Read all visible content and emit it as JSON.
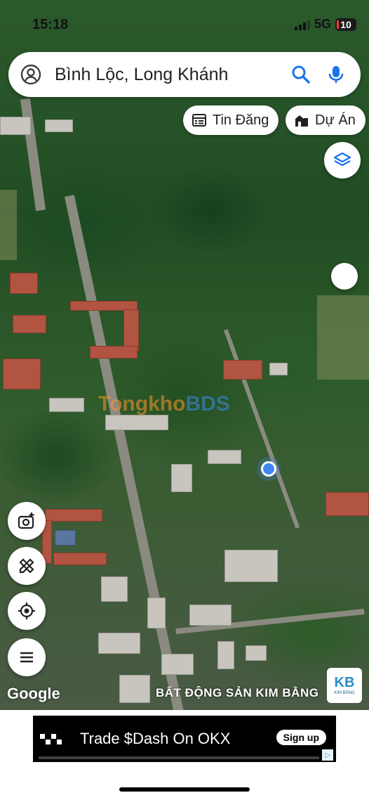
{
  "status_bar": {
    "time": "15:18",
    "network": "5G",
    "battery": "10"
  },
  "search": {
    "query": "Bình Lộc, Long Khánh"
  },
  "chips": [
    {
      "label": "Tin Đăng",
      "icon": "calendar-list-icon"
    },
    {
      "label": "Dự Án",
      "icon": "buildings-icon"
    }
  ],
  "map_watermark": {
    "part1": "Tongkho",
    "part2": "BDS"
  },
  "map_attribution": "Google",
  "agency_label": "BẤT ĐỘNG SẢN KIM BẰNG",
  "agency_logo": {
    "mark": "KB",
    "caption": "KIM BẰNG"
  },
  "ad": {
    "brand": "OKX",
    "headline": "Trade $Dash On OKX",
    "cta": "Sign up"
  },
  "colors": {
    "accent_blue": "#1a73e8",
    "location_dot": "#4285f4"
  }
}
